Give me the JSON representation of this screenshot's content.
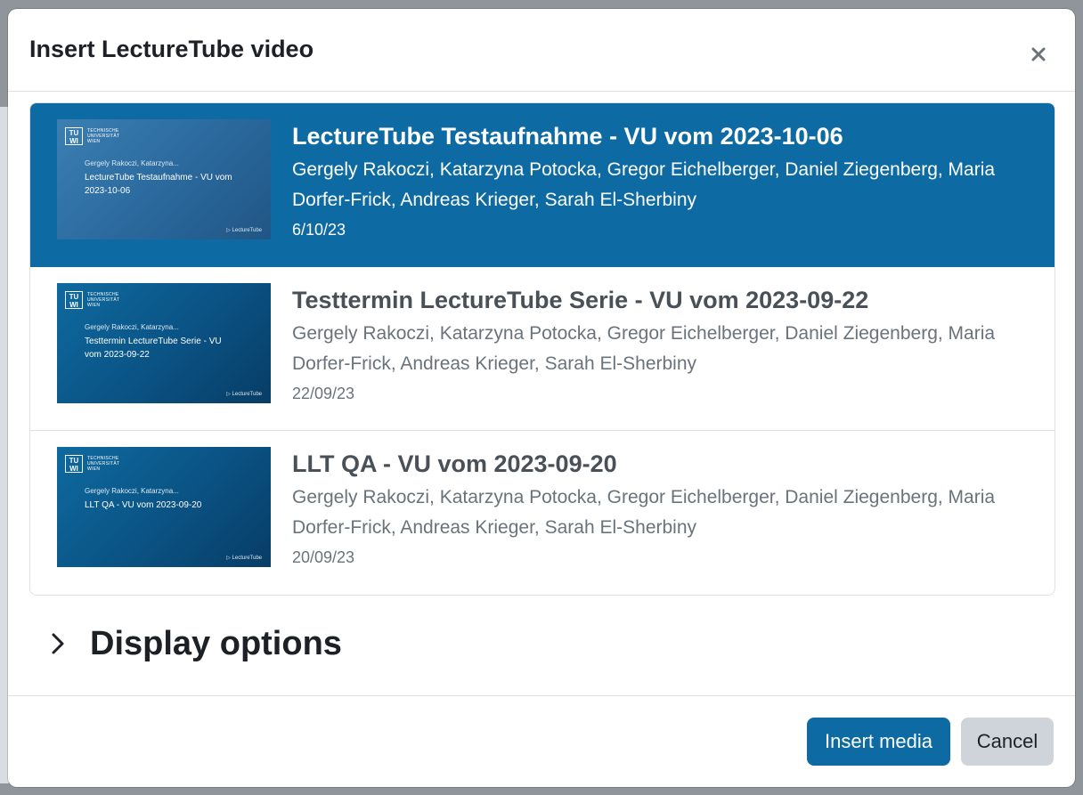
{
  "dialog": {
    "title": "Insert LectureTube video",
    "close_label": "×"
  },
  "videos": [
    {
      "title": "LectureTube Testaufnahme - VU vom 2023-10-06",
      "authors": "Gergely Rakoczi, Katarzyna Potocka, Gregor Eichelberger, Daniel Ziegenberg, Maria Dorfer-Frick, Andreas Krieger, Sarah El-Sherbiny",
      "date": "6/10/23",
      "selected": true,
      "thumbnail": {
        "authors": "Gergely Rakoczi, Katarzyna...",
        "title": "LectureTube Testaufnahme - VU vom 2023-10-06"
      }
    },
    {
      "title": "Testtermin LectureTube Serie - VU vom 2023-09-22",
      "authors": "Gergely Rakoczi, Katarzyna Potocka, Gregor Eichelberger, Daniel Ziegenberg, Maria Dorfer-Frick, Andreas Krieger, Sarah El-Sherbiny",
      "date": "22/09/23",
      "selected": false,
      "thumbnail": {
        "authors": "Gergely Rakoczi, Katarzyna...",
        "title": "Testtermin LectureTube Serie - VU vom 2023-09-22"
      }
    },
    {
      "title": "LLT QA - VU vom 2023-09-20",
      "authors": "Gergely Rakoczi, Katarzyna Potocka, Gregor Eichelberger, Daniel Ziegenberg, Maria Dorfer-Frick, Andreas Krieger, Sarah El-Sherbiny",
      "date": "20/09/23",
      "selected": false,
      "thumbnail": {
        "authors": "Gergely Rakoczi, Katarzyna...",
        "title": "LLT QA - VU vom 2023-09-20"
      }
    }
  ],
  "thumbnail_common": {
    "logo": "TU\nWIEN",
    "institution": "TECHNISCHE\nUNIVERSITÄT\nWIEN",
    "brand": "LectureTube"
  },
  "display_options": {
    "label": "Display options",
    "icon": "chevron-right-icon"
  },
  "footer": {
    "insert_label": "Insert media",
    "cancel_label": "Cancel"
  },
  "colors": {
    "accent": "#0d6aa3",
    "secondary_button": "#ced4da"
  }
}
